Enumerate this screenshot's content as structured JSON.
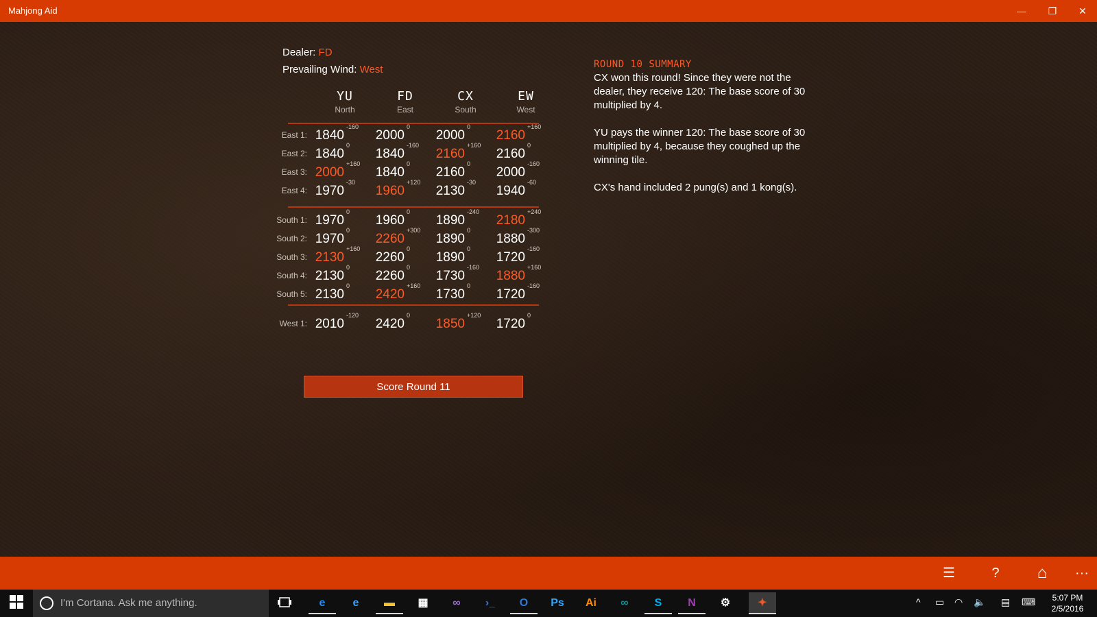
{
  "window": {
    "title": "Mahjong Aid",
    "minimize_glyph": "—",
    "restore_glyph": "❐",
    "close_glyph": "✕"
  },
  "info": {
    "dealer_label": "Dealer:",
    "dealer_value": "FD",
    "wind_label": "Prevailing Wind:",
    "wind_value": "West"
  },
  "players": [
    {
      "name": "YU",
      "wind": "North"
    },
    {
      "name": "FD",
      "wind": "East"
    },
    {
      "name": "CX",
      "wind": "South"
    },
    {
      "name": "EW",
      "wind": "West"
    }
  ],
  "rounds": [
    {
      "label": "East 1:",
      "cells": [
        {
          "score": "1840",
          "delta": "-160",
          "win": false
        },
        {
          "score": "2000",
          "delta": "0",
          "win": false
        },
        {
          "score": "2000",
          "delta": "0",
          "win": false
        },
        {
          "score": "2160",
          "delta": "+160",
          "win": true
        }
      ]
    },
    {
      "label": "East 2:",
      "cells": [
        {
          "score": "1840",
          "delta": "0",
          "win": false
        },
        {
          "score": "1840",
          "delta": "-160",
          "win": false
        },
        {
          "score": "2160",
          "delta": "+160",
          "win": true
        },
        {
          "score": "2160",
          "delta": "0",
          "win": false
        }
      ]
    },
    {
      "label": "East 3:",
      "cells": [
        {
          "score": "2000",
          "delta": "+160",
          "win": true
        },
        {
          "score": "1840",
          "delta": "0",
          "win": false
        },
        {
          "score": "2160",
          "delta": "0",
          "win": false
        },
        {
          "score": "2000",
          "delta": "-160",
          "win": false
        }
      ]
    },
    {
      "label": "East 4:",
      "cells": [
        {
          "score": "1970",
          "delta": "-30",
          "win": false
        },
        {
          "score": "1960",
          "delta": "+120",
          "win": true
        },
        {
          "score": "2130",
          "delta": "-30",
          "win": false
        },
        {
          "score": "1940",
          "delta": "-60",
          "win": false
        }
      ]
    },
    {
      "label": "South 1:",
      "cells": [
        {
          "score": "1970",
          "delta": "0",
          "win": false
        },
        {
          "score": "1960",
          "delta": "0",
          "win": false
        },
        {
          "score": "1890",
          "delta": "-240",
          "win": false
        },
        {
          "score": "2180",
          "delta": "+240",
          "win": true
        }
      ]
    },
    {
      "label": "South 2:",
      "cells": [
        {
          "score": "1970",
          "delta": "0",
          "win": false
        },
        {
          "score": "2260",
          "delta": "+300",
          "win": true
        },
        {
          "score": "1890",
          "delta": "0",
          "win": false
        },
        {
          "score": "1880",
          "delta": "-300",
          "win": false
        }
      ]
    },
    {
      "label": "South 3:",
      "cells": [
        {
          "score": "2130",
          "delta": "+160",
          "win": true
        },
        {
          "score": "2260",
          "delta": "0",
          "win": false
        },
        {
          "score": "1890",
          "delta": "0",
          "win": false
        },
        {
          "score": "1720",
          "delta": "-160",
          "win": false
        }
      ]
    },
    {
      "label": "South 4:",
      "cells": [
        {
          "score": "2130",
          "delta": "0",
          "win": false
        },
        {
          "score": "2260",
          "delta": "0",
          "win": false
        },
        {
          "score": "1730",
          "delta": "-160",
          "win": false
        },
        {
          "score": "1880",
          "delta": "+160",
          "win": true
        }
      ]
    },
    {
      "label": "South 5:",
      "cells": [
        {
          "score": "2130",
          "delta": "0",
          "win": false
        },
        {
          "score": "2420",
          "delta": "+160",
          "win": true
        },
        {
          "score": "1730",
          "delta": "0",
          "win": false
        },
        {
          "score": "1720",
          "delta": "-160",
          "win": false
        }
      ]
    },
    {
      "label": "West 1:",
      "cells": [
        {
          "score": "2010",
          "delta": "-120",
          "win": false
        },
        {
          "score": "2420",
          "delta": "0",
          "win": false
        },
        {
          "score": "1850",
          "delta": "+120",
          "win": true
        },
        {
          "score": "1720",
          "delta": "0",
          "win": false
        }
      ]
    }
  ],
  "score_button": "Score Round 11",
  "summary": {
    "title": "ROUND 10 SUMMARY",
    "paragraphs": [
      "CX won this round! Since they were not the dealer, they receive 120: The base score of 30 multiplied by 4.",
      "YU pays the winner 120: The base score of 30 multiplied by 4, because they coughed up the winning tile.",
      "CX's hand included 2 pung(s) and 1 kong(s)."
    ]
  },
  "appbar": {
    "icons": [
      "list-icon",
      "help-icon",
      "home-icon",
      "more-icon"
    ],
    "list_glyph": "☰",
    "help_glyph": "?",
    "home_glyph": "⌂",
    "more_glyph": "···"
  },
  "taskbar": {
    "cortana_placeholder": "I'm Cortana. Ask me anything.",
    "time": "5:07 PM",
    "date": "2/5/2016",
    "apps": [
      {
        "icon": "edge-icon",
        "glyph": "e",
        "color": "#1e90ff"
      },
      {
        "icon": "internet-explorer-icon",
        "glyph": "e",
        "color": "#3aa0ff"
      },
      {
        "icon": "file-explorer-icon",
        "glyph": "▬",
        "color": "#f2c233"
      },
      {
        "icon": "store-icon",
        "glyph": "▦",
        "color": "#ffffff"
      },
      {
        "icon": "visual-studio-icon",
        "glyph": "∞",
        "color": "#9b6bd6"
      },
      {
        "icon": "powershell-icon",
        "glyph": "›_",
        "color": "#3a78d8"
      },
      {
        "icon": "outlook-icon",
        "glyph": "O",
        "color": "#2f7bd4"
      },
      {
        "icon": "photoshop-icon",
        "glyph": "Ps",
        "color": "#31a8ff"
      },
      {
        "icon": "illustrator-icon",
        "glyph": "Ai",
        "color": "#ff8a00"
      },
      {
        "icon": "arduino-icon",
        "glyph": "∞",
        "color": "#00979d"
      },
      {
        "icon": "skype-icon",
        "glyph": "S",
        "color": "#00aff0"
      },
      {
        "icon": "onenote-icon",
        "glyph": "N",
        "color": "#a33bb5"
      },
      {
        "icon": "settings-icon",
        "glyph": "⚙",
        "color": "#ffffff"
      },
      {
        "icon": "mahjong-aid-icon",
        "glyph": "✦",
        "color": "#e85a2a"
      }
    ]
  },
  "colors": {
    "accent": "#d83b01",
    "highlight": "#ff5a26"
  }
}
